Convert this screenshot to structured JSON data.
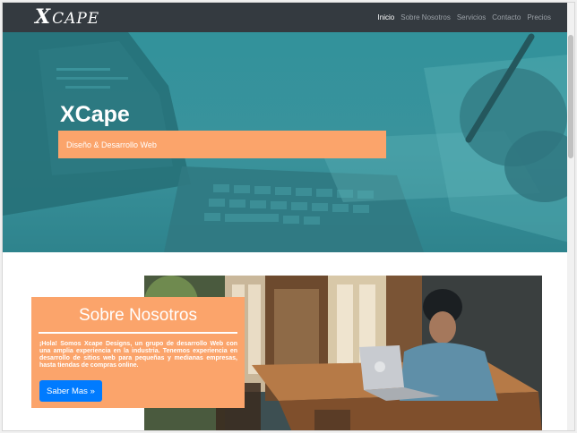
{
  "navbar": {
    "brand_mark": "X",
    "brand_text": "CAPE",
    "links": [
      {
        "label": "Inicio",
        "active": true
      },
      {
        "label": "Sobre Nosotros",
        "active": false
      },
      {
        "label": "Servicios",
        "active": false
      },
      {
        "label": "Contacto",
        "active": false
      },
      {
        "label": "Precios",
        "active": false
      }
    ]
  },
  "hero": {
    "title": "XCape",
    "subtitle": "Diseño & Desarrollo Web"
  },
  "about": {
    "title": "Sobre Nosotros",
    "text": "¡Hola! Somos Xcape Designs, un grupo de desarrollo Web con una amplia experiencia en la industria. Tenemos experiencia en desarrollo de sitios web para pequeñas y medianas empresas, hasta tiendas de compras online.",
    "button_label": "Saber Mas »"
  },
  "colors": {
    "navbar_bg": "#343a40",
    "accent_orange": "#fba46b",
    "button_blue": "#007bff",
    "hero_teal": "#2f8e97"
  }
}
